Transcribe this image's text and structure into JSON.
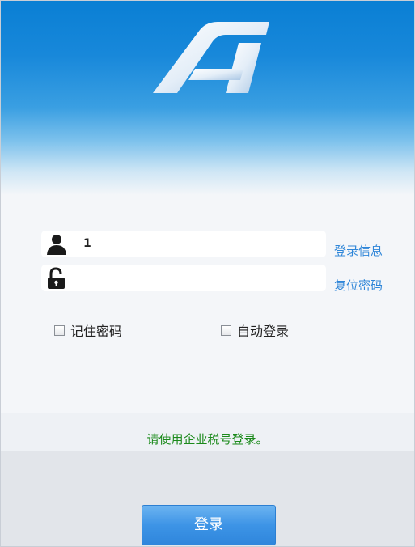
{
  "login": {
    "username_value": "1",
    "password_value": "",
    "login_info_link": "登录信息",
    "reset_password_link": "复位密码",
    "remember_password_label": "记住密码",
    "auto_login_label": "自动登录",
    "remember_password_checked": false,
    "auto_login_checked": false,
    "notice": "请使用企业税号登录。",
    "login_button": "登录"
  },
  "icons": {
    "logo": "app-logo-a",
    "user": "user-icon",
    "lock": "unlocked-padlock-icon"
  },
  "colors": {
    "banner_blue": "#0a7fd4",
    "link_blue": "#2f86d8",
    "notice_green": "#1b8a1b",
    "button_blue": "#3d94e6"
  }
}
